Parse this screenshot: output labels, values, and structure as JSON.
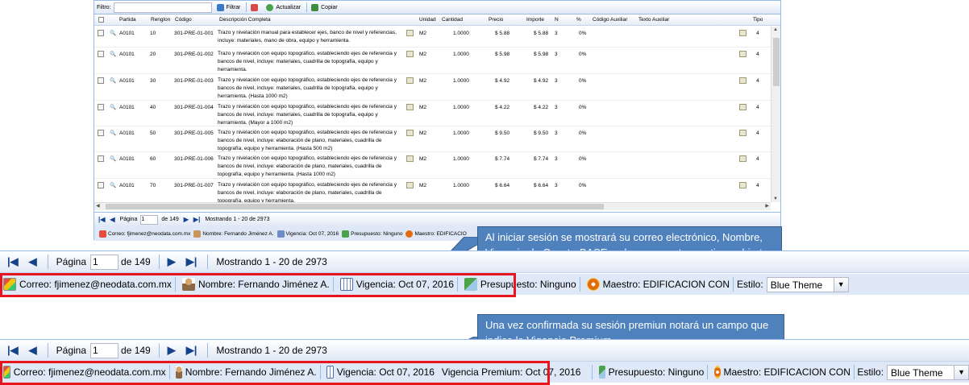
{
  "grid": {
    "toolbar": {
      "filter_label": "Filtro:",
      "filter_button": "Filtrar",
      "refresh_button": "Actualizar",
      "copy_button": "Copiar"
    },
    "columns": [
      "Partida",
      "Renglon",
      "Código",
      "Descripción Completa",
      "Unidad",
      "Cantidad",
      "Precio",
      "Importe",
      "N",
      "%",
      "Código Auxiliar",
      "Texto Auxiliar",
      "Tipo"
    ],
    "rows": [
      {
        "partida": "A0101",
        "renglon": "10",
        "codigo": "301-PRE-01-001",
        "descripcion": "Trazo y nivelación manual para establecer ejes, banco de nivel y referencias, incluye: materiales, mano de obra, equipo y herramienta.",
        "unidad": "M2",
        "cantidad": "1.0000",
        "precio": "$ 5.88",
        "importe": "$ 5.88",
        "n": "3",
        "pct": "0%",
        "tipo": "4"
      },
      {
        "partida": "A0101",
        "renglon": "20",
        "codigo": "301-PRE-01-002",
        "descripcion": "Trazo y nivelación con equipo topográfico, estableciendo ejes de referencia y bancos de nivel, incluye: materiales, cuadrilla de topografía, equipo y herramienta.",
        "unidad": "M2",
        "cantidad": "1.0000",
        "precio": "$ 5.98",
        "importe": "$ 5.98",
        "n": "3",
        "pct": "0%",
        "tipo": "4"
      },
      {
        "partida": "A0101",
        "renglon": "30",
        "codigo": "301-PRE-01-003",
        "descripcion": "Trazo y nivelación con equipo topográfico, estableciendo ejes de referencia y bancos de nivel, incluye: materiales, cuadrilla de topografía, equipo y herramienta. (Hasta 1000 m2)",
        "unidad": "M2",
        "cantidad": "1.0000",
        "precio": "$ 4.92",
        "importe": "$ 4.92",
        "n": "3",
        "pct": "0%",
        "tipo": "4"
      },
      {
        "partida": "A0101",
        "renglon": "40",
        "codigo": "301-PRE-01-004",
        "descripcion": "Trazo y nivelación con equipo topográfico, estableciendo ejes de referencia y bancos de nivel, incluye: materiales, cuadrilla de topografía, equipo y herramienta. (Mayor a 1000 m2)",
        "unidad": "M2",
        "cantidad": "1.0000",
        "precio": "$ 4.22",
        "importe": "$ 4.22",
        "n": "3",
        "pct": "0%",
        "tipo": "4"
      },
      {
        "partida": "A0101",
        "renglon": "50",
        "codigo": "301-PRE-01-005",
        "descripcion": "Trazo y nivelación con equipo topográfico, estableciendo ejes de referencia y bancos de nivel, incluye: elaboración de plano, materiales, cuadrilla de topografía, equipo y herramienta. (Hasta 500 m2)",
        "unidad": "M2",
        "cantidad": "1.0000",
        "precio": "$ 9.50",
        "importe": "$ 9.50",
        "n": "3",
        "pct": "0%",
        "tipo": "4"
      },
      {
        "partida": "A0101",
        "renglon": "60",
        "codigo": "301-PRE-01-006",
        "descripcion": "Trazo y nivelación con equipo topográfico, estableciendo ejes de referencia y bancos de nivel, incluye: elaboración de plano, materiales, cuadrilla de topografía, equipo y herramienta. (Hasta 1000 m2)",
        "unidad": "M2",
        "cantidad": "1.0000",
        "precio": "$ 7.74",
        "importe": "$ 7.74",
        "n": "3",
        "pct": "0%",
        "tipo": "4"
      },
      {
        "partida": "A0101",
        "renglon": "70",
        "codigo": "301-PRE-01-007",
        "descripcion": "Trazo y nivelación con equipo topográfico, estableciendo ejes de referencia y bancos de nivel, incluye: elaboración de plano, materiales, cuadrilla de topografía, equipo y herramienta.",
        "unidad": "M2",
        "cantidad": "1.0000",
        "precio": "$ 6.64",
        "importe": "$ 6.64",
        "n": "3",
        "pct": "0%",
        "tipo": "4"
      }
    ],
    "pager": {
      "page_label": "Página",
      "page_value": "1",
      "of_label": "de 149",
      "showing": "Mostrando 1 - 20 de 2973"
    },
    "status": {
      "email": "Correo: fjimenez@neodata.com.mx",
      "name": "Nombre: Fernando Jiménez A.",
      "vigencia": "Vigencia: Oct 07, 2016",
      "presupuesto": "Presupuesto: Ninguno",
      "maestro": "Maestro: EDIFICACIO"
    }
  },
  "callout1": {
    "text": "Al iniciar sesión se mostrará su correo electrónico, Nombre, Vigencia de ConstruBASE y el presupuesto que tiene abierto."
  },
  "callout2": {
    "text": "Una vez confirmada su sesión premiun notará un campo que indica la Vigencia Premium."
  },
  "bar1": {
    "pager": {
      "page_label": "Página",
      "page_value": "1",
      "of_label": "de 149",
      "showing": "Mostrando 1 - 20 de 2973"
    },
    "status": {
      "email": "Correo: fjimenez@neodata.com.mx",
      "name": "Nombre: Fernando Jiménez A.",
      "vigencia": "Vigencia: Oct 07, 2016",
      "presupuesto": "Presupuesto: Ninguno",
      "maestro": "Maestro: EDIFICACION CON",
      "estilo_label": "Estilo:",
      "estilo_value": "Blue Theme"
    }
  },
  "bar2": {
    "pager": {
      "page_label": "Página",
      "page_value": "1",
      "of_label": "de 149",
      "showing": "Mostrando 1 - 20 de 2973"
    },
    "status": {
      "email": "Correo: fjimenez@neodata.com.mx",
      "name": "Nombre: Fernando Jiménez A.",
      "vigencia": "Vigencia: Oct 07, 2016",
      "vigencia_premium": "Vigencia Premium: Oct 07, 2016",
      "presupuesto": "Presupuesto: Ninguno",
      "maestro": "Maestro: EDIFICACION CON",
      "estilo_label": "Estilo:",
      "estilo_value": "Blue Theme"
    }
  },
  "colors": {
    "callout": "#4f81bd",
    "highlight": "#e8141e",
    "toolbar": "#dfe8f6",
    "nav": "#15428b"
  }
}
